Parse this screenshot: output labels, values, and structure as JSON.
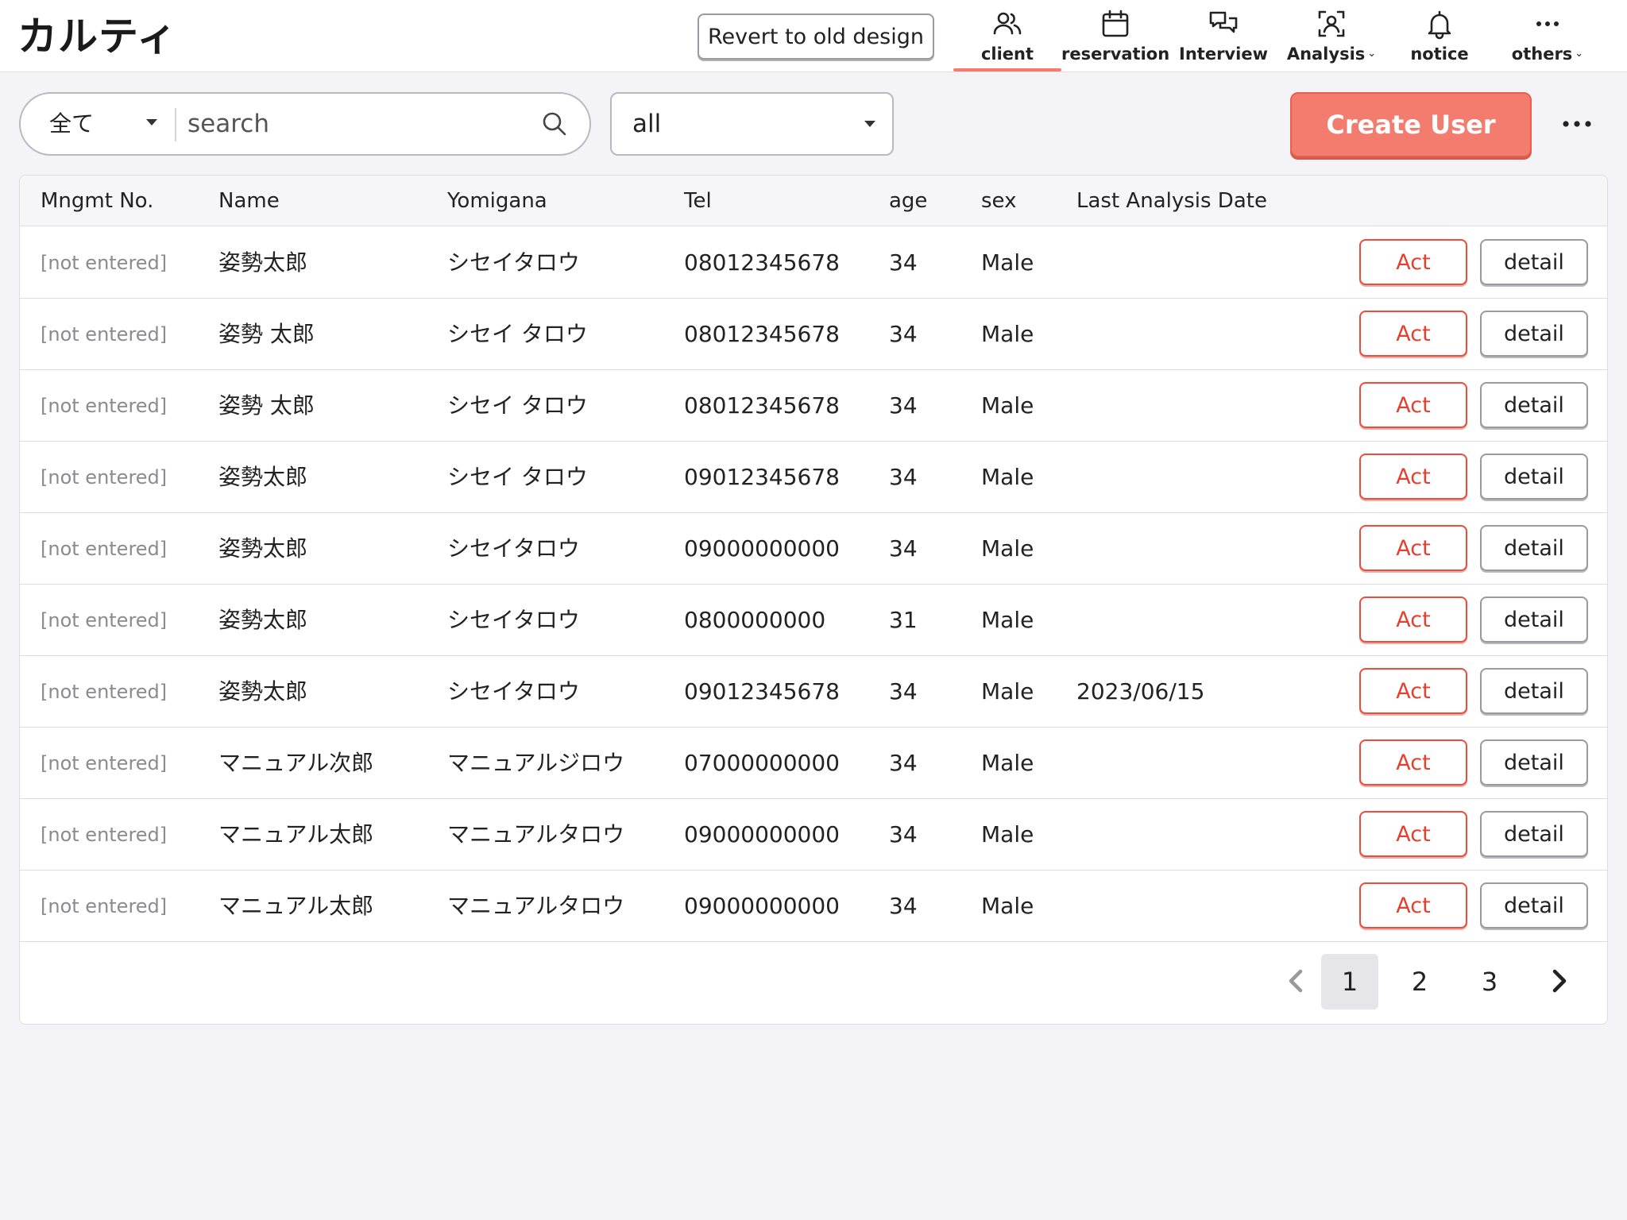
{
  "app": {
    "title": "カルティ"
  },
  "header": {
    "revert_label": "Revert to old design",
    "nav": [
      {
        "key": "client",
        "label": "client",
        "icon": "users-icon",
        "active": true,
        "has_menu": false
      },
      {
        "key": "reservation",
        "label": "reservation",
        "icon": "calendar-icon",
        "active": false,
        "has_menu": false
      },
      {
        "key": "interview",
        "label": "Interview",
        "icon": "chat-bubbles-icon",
        "active": false,
        "has_menu": false
      },
      {
        "key": "analysis",
        "label": "Analysis",
        "icon": "person-scan-icon",
        "active": false,
        "has_menu": true
      },
      {
        "key": "notice",
        "label": "notice",
        "icon": "bell-icon",
        "active": false,
        "has_menu": false
      },
      {
        "key": "others",
        "label": "others",
        "icon": "dots-icon",
        "active": false,
        "has_menu": true
      }
    ]
  },
  "toolbar": {
    "scope_value": "全て",
    "search_placeholder": "search",
    "filter_value": "all",
    "create_label": "Create User"
  },
  "table": {
    "columns": [
      "Mngmt No.",
      "Name",
      "Yomigana",
      "Tel",
      "age",
      "sex",
      "Last Analysis Date"
    ],
    "act_label": "Act",
    "detail_label": "detail",
    "rows": [
      {
        "mngmt": "[not entered]",
        "name": "姿勢太郎",
        "yomigana": "シセイタロウ",
        "tel": "08012345678",
        "age": "34",
        "sex": "Male",
        "last_analysis": ""
      },
      {
        "mngmt": "[not entered]",
        "name": "姿勢 太郎",
        "yomigana": "シセイ タロウ",
        "tel": "08012345678",
        "age": "34",
        "sex": "Male",
        "last_analysis": ""
      },
      {
        "mngmt": "[not entered]",
        "name": "姿勢 太郎",
        "yomigana": "シセイ タロウ",
        "tel": "08012345678",
        "age": "34",
        "sex": "Male",
        "last_analysis": ""
      },
      {
        "mngmt": "[not entered]",
        "name": "姿勢太郎",
        "yomigana": "シセイ タロウ",
        "tel": "09012345678",
        "age": "34",
        "sex": "Male",
        "last_analysis": ""
      },
      {
        "mngmt": "[not entered]",
        "name": "姿勢太郎",
        "yomigana": "シセイタロウ",
        "tel": "09000000000",
        "age": "34",
        "sex": "Male",
        "last_analysis": ""
      },
      {
        "mngmt": "[not entered]",
        "name": "姿勢太郎",
        "yomigana": "シセイタロウ",
        "tel": "0800000000",
        "age": "31",
        "sex": "Male",
        "last_analysis": ""
      },
      {
        "mngmt": "[not entered]",
        "name": "姿勢太郎",
        "yomigana": "シセイタロウ",
        "tel": "09012345678",
        "age": "34",
        "sex": "Male",
        "last_analysis": "2023/06/15"
      },
      {
        "mngmt": "[not entered]",
        "name": "マニュアル次郎",
        "yomigana": "マニュアルジロウ",
        "tel": "07000000000",
        "age": "34",
        "sex": "Male",
        "last_analysis": ""
      },
      {
        "mngmt": "[not entered]",
        "name": "マニュアル太郎",
        "yomigana": "マニュアルタロウ",
        "tel": "09000000000",
        "age": "34",
        "sex": "Male",
        "last_analysis": ""
      },
      {
        "mngmt": "[not entered]",
        "name": "マニュアル太郎",
        "yomigana": "マニュアルタロウ",
        "tel": "09000000000",
        "age": "34",
        "sex": "Male",
        "last_analysis": ""
      }
    ]
  },
  "pagination": {
    "pages": [
      "1",
      "2",
      "3"
    ],
    "current": "1"
  },
  "colors": {
    "accent": "#f47c6e",
    "act_red": "#e5402f",
    "background": "#f4f4f8"
  }
}
